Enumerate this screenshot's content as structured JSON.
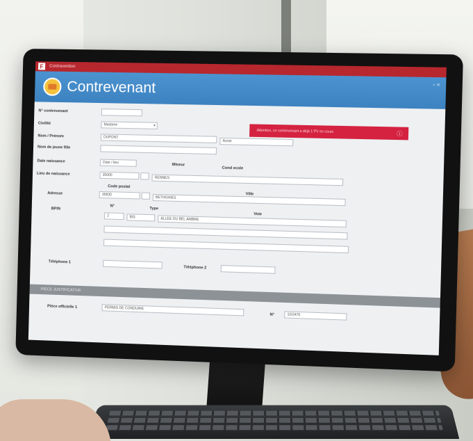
{
  "app": {
    "window_title": "Contravention",
    "logo_letter": "F",
    "page_title": "Contrevenant",
    "close_glyph": "▫ ×"
  },
  "alert": {
    "text": "Attention, ce contrevenant a déjà 1 PV en cours",
    "icon": "ⓘ"
  },
  "form": {
    "n_contrevenant_label": "N° contrevenant",
    "civilite_label": "Civilité",
    "civilite_value": "Madame",
    "nom_prenom_label": "Nom / Prénom",
    "nom_value": "DUPONT",
    "prenom_value": "Annie",
    "nom_jeune_fille_label": "Nom de jeune fille",
    "date_naissance_label": "Date naissance",
    "date_naissance_value": "Date / lieu",
    "mineur_label": "Mineur",
    "cond_ecole_label": "Cond ecole",
    "lieu_naissance_label": "Lieu de naissance",
    "lieu_cp_value": "35000",
    "lieu_ville_value": "RENNES",
    "code_postal_label": "Code postal",
    "ville_label": "Ville",
    "adresse_label": "Adresse",
    "adresse_cp_value": "35830",
    "adresse_ville_value": "BETHGHIES",
    "n_label": "N°",
    "type_label": "Type",
    "voie_label": "Voie",
    "appt_label": "BP/N",
    "numero_value": "2",
    "type_value": "BIS",
    "voie_value": "ALLEE DU BEL AMBRE",
    "telephone1_label": "Téléphone 1",
    "telephone2_label": "Téléphone 2"
  },
  "section": {
    "title": "PIECE JUSTIFICATIVE"
  },
  "piece": {
    "label": "Pièce officielle 1",
    "value": "PERMIS DE CONDUIRE",
    "n_label": "N°",
    "n_value": "10/2476"
  }
}
